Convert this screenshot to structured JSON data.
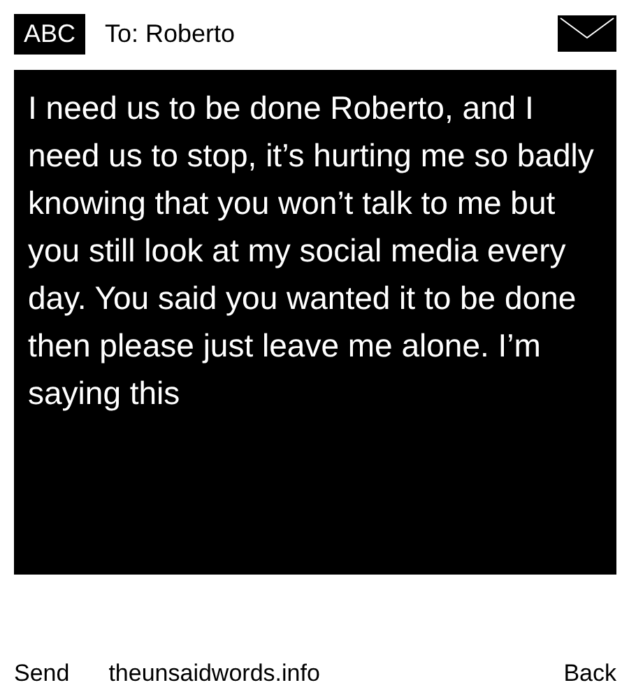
{
  "header": {
    "mode": "ABC",
    "recipient": "To: Roberto"
  },
  "message": {
    "text": "I need us to be done Roberto, and I need us to stop, it’s hurting me so badly knowing that you won’t talk to me but you still look at my social media every day. You said you wanted it to be done then please just leave me alone. I’m saying this"
  },
  "footer": {
    "left": "Send",
    "center": "theunsaidwords.info",
    "right": "Back"
  }
}
